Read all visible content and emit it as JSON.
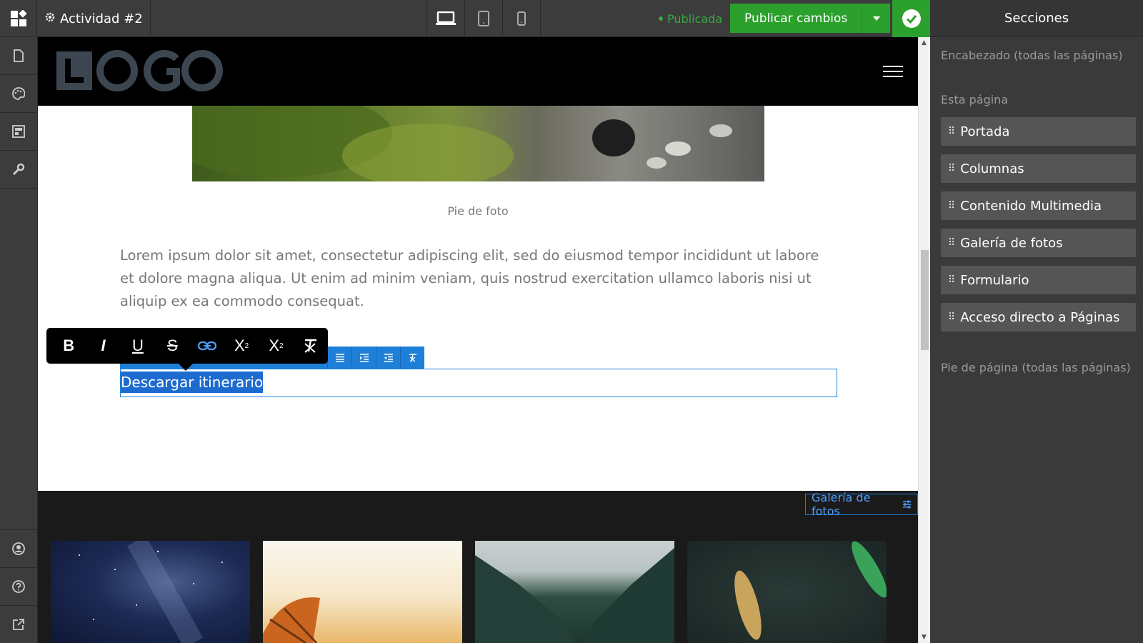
{
  "topbar": {
    "site_title": "Actividad #2",
    "status": "Publicada",
    "publish_label": "Publicar cambios"
  },
  "canvas": {
    "logo_text": "LOGO",
    "caption": "Pie de foto",
    "lorem": "Lorem ipsum dolor sit amet, consectetur adipiscing elit, sed do eiusmod tempor incididunt ut labore et dolore magna aliqua. Ut enim ad minim veniam, quis nostrud exercitation ullamco laboris nisi ut aliquip ex ea commodo consequat.",
    "selected_text": "Descargar itinerario",
    "gallery_tag": "Galería de fotos"
  },
  "format_toolbar": {
    "bold": "B",
    "italic": "I",
    "underline": "U",
    "strikethrough": "S",
    "superscript": "X",
    "subscript": "X"
  },
  "panel": {
    "title": "Secciones",
    "header_group": "Encabezado (todas las páginas)",
    "page_group": "Esta página",
    "items": [
      "Portada",
      "Columnas",
      "Contenido Multimedia",
      "Galería de fotos",
      "Formulario",
      "Acceso directo a Páginas"
    ],
    "footer_group": "Pie de página (todas las páginas)"
  },
  "colors": {
    "accent_green": "#2ca02c",
    "accent_blue": "#1e7fd9",
    "panel_bg": "#3a3a3a"
  }
}
